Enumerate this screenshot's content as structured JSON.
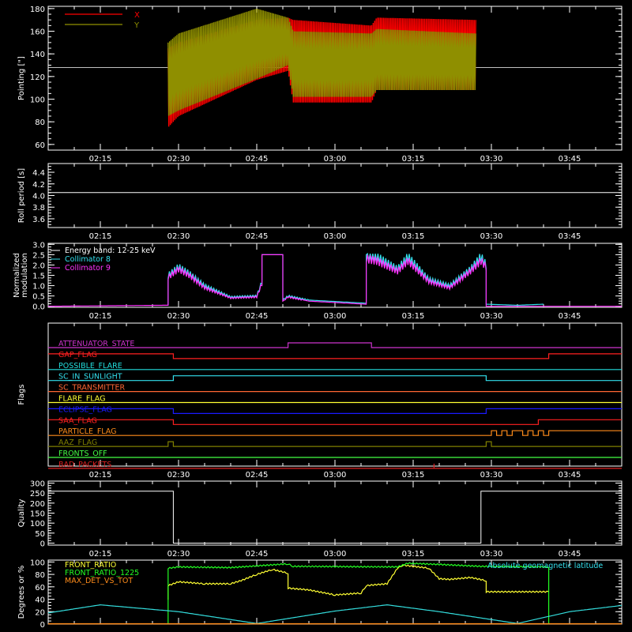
{
  "colors": {
    "background": "#000000",
    "axis": "#ffffff",
    "x": "#ff0000",
    "y": "#8f8f00",
    "cyan": "#33e0ee",
    "magenta": "#ff33ff",
    "green": "#22ff22",
    "yellow": "#ffff33",
    "orange": "#ff8c1a",
    "blue": "#1a1aff",
    "red": "#ff2020",
    "olive": "#808000",
    "lightgreen": "#44ff44",
    "darkred": "#dd2020"
  },
  "time_ticks": [
    "02:15",
    "02:30",
    "02:45",
    "03:00",
    "03:15",
    "03:30",
    "03:45"
  ],
  "chart_data": [
    {
      "name": "pointing",
      "type": "area",
      "ylabel": "Pointing [\"]",
      "ylim": [
        55,
        182
      ],
      "yticks": [
        60,
        80,
        100,
        120,
        140,
        160,
        180
      ],
      "reference_line": 128,
      "legend": [
        "X",
        "Y"
      ],
      "envelopes": [
        {
          "name": "X",
          "color": "#ff0000",
          "x": [
            "02:28",
            "02:30",
            "02:45",
            "02:51",
            "02:52",
            "03:07",
            "03:08",
            "03:27"
          ],
          "min": [
            75,
            85,
            117,
            125,
            97,
            97,
            108,
            108
          ],
          "max": [
            145,
            150,
            170,
            172,
            170,
            165,
            172,
            170
          ]
        },
        {
          "name": "Y",
          "color": "#8f8f00",
          "x": [
            "02:28",
            "02:30",
            "02:45",
            "02:51",
            "02:52",
            "03:07",
            "03:08",
            "03:27"
          ],
          "min": [
            85,
            90,
            118,
            130,
            102,
            102,
            108,
            108
          ],
          "max": [
            150,
            158,
            180,
            172,
            160,
            158,
            162,
            158
          ]
        }
      ]
    },
    {
      "name": "roll-period",
      "type": "line",
      "ylabel": "Roll period [s]",
      "ylim": [
        3.45,
        4.55
      ],
      "yticks": [
        "3.6",
        "3.8",
        "4.0",
        "4.2",
        "4.4"
      ],
      "series": [
        {
          "color": "#ffffff",
          "x": [
            "02:05",
            "03:55"
          ],
          "y": [
            4.05,
            4.05
          ]
        }
      ]
    },
    {
      "name": "modulation",
      "type": "line",
      "ylabel": [
        "Normalized",
        "modulation"
      ],
      "ylim": [
        -0.05,
        3.05
      ],
      "yticks": [
        "0.0",
        "0.5",
        "1.0",
        "1.5",
        "2.0",
        "2.5",
        "3.0"
      ],
      "legend": [
        "Energy band: 12-25 keV",
        "Collimator 8",
        "Collimator 9"
      ],
      "series": [
        {
          "name": "Collimator 8",
          "color": "#33e0ee",
          "x": [
            "02:28",
            "02:28",
            "02:30",
            "02:32",
            "02:35",
            "02:40",
            "02:45",
            "02:46",
            "02:46",
            "02:50",
            "02:50",
            "02:51",
            "02:55",
            "03:06",
            "03:06",
            "03:08",
            "03:12",
            "03:14",
            "03:18",
            "03:22",
            "03:26",
            "03:28",
            "03:29",
            "03:29",
            "03:35",
            "03:40"
          ],
          "y": [
            0.05,
            1.5,
            1.9,
            1.6,
            1.0,
            0.45,
            0.5,
            1.2,
            2.5,
            2.5,
            0.3,
            0.5,
            0.3,
            0.15,
            2.5,
            2.4,
            1.8,
            2.4,
            1.3,
            1.0,
            1.8,
            2.4,
            2.0,
            0.1,
            0.05,
            0.1
          ]
        },
        {
          "name": "Collimator 9",
          "color": "#ff33ff",
          "x": [
            "02:05",
            "02:28",
            "02:28",
            "02:30",
            "02:32",
            "02:35",
            "02:40",
            "02:45",
            "02:46",
            "02:46",
            "02:50",
            "02:50",
            "02:51",
            "02:55",
            "03:06",
            "03:06",
            "03:08",
            "03:12",
            "03:14",
            "03:18",
            "03:22",
            "03:26",
            "03:28",
            "03:29",
            "03:29",
            "03:55"
          ],
          "y": [
            0.0,
            0.05,
            1.4,
            1.8,
            1.5,
            0.9,
            0.4,
            0.45,
            1.1,
            2.5,
            2.5,
            0.25,
            0.45,
            0.25,
            0.1,
            2.3,
            2.2,
            1.7,
            2.2,
            1.2,
            0.9,
            1.7,
            2.2,
            1.9,
            0.0,
            0.0
          ]
        }
      ]
    },
    {
      "name": "flags",
      "type": "line",
      "ylabel": "Flags",
      "flags": [
        {
          "label": "ATTENUATOR_STATE",
          "color": "#cc33cc",
          "x": [
            "02:05",
            "02:51",
            "02:51",
            "03:07",
            "03:07",
            "03:55"
          ],
          "y": [
            0,
            0,
            1,
            1,
            0,
            0
          ]
        },
        {
          "label": "GAP_FLAG",
          "color": "#ff2020",
          "x": [
            "02:05",
            "02:29",
            "02:29",
            "03:41",
            "03:41",
            "03:55"
          ],
          "y": [
            1,
            1,
            0,
            0,
            1,
            1
          ]
        },
        {
          "label": "POSSIBLE_FLARE",
          "color": "#22dddd",
          "x": [
            "02:05",
            "03:55"
          ],
          "y": [
            0,
            0
          ]
        },
        {
          "label": "SC_IN_SUNLIGHT",
          "color": "#33e0ee",
          "x": [
            "02:05",
            "02:29",
            "02:29",
            "03:29",
            "03:29",
            "03:55"
          ],
          "y": [
            0,
            0,
            1,
            1,
            0,
            0
          ]
        },
        {
          "label": "SC_TRANSMITTER",
          "color": "#ff6633",
          "x": [
            "02:05",
            "03:55"
          ],
          "y": [
            0,
            0
          ]
        },
        {
          "label": "FLARE_FLAG",
          "color": "#ffff33",
          "x": [
            "02:05",
            "03:55"
          ],
          "y": [
            0,
            0
          ]
        },
        {
          "label": "ECLIPSE_FLAG",
          "color": "#1a1aff",
          "x": [
            "02:05",
            "02:29",
            "02:29",
            "03:29",
            "03:29",
            "03:55"
          ],
          "y": [
            1,
            1,
            0,
            0,
            1,
            1
          ]
        },
        {
          "label": "SAA_FLAG",
          "color": "#ff2020",
          "x": [
            "02:05",
            "02:29",
            "02:29",
            "03:39",
            "03:39",
            "03:55"
          ],
          "y": [
            1,
            1,
            0,
            0,
            1,
            1
          ]
        },
        {
          "label": "PARTICLE_FLAG",
          "color": "#ff8c1a",
          "x": [
            "02:05",
            "03:30",
            "03:30",
            "03:31",
            "03:31",
            "03:32",
            "03:32",
            "03:33",
            "03:33",
            "03:34",
            "03:34",
            "03:36",
            "03:36",
            "03:37",
            "03:37",
            "03:38",
            "03:38",
            "03:39",
            "03:39",
            "03:40",
            "03:40",
            "03:41",
            "03:41",
            "03:55"
          ],
          "y": [
            0,
            0,
            1,
            1,
            0,
            0,
            1,
            1,
            0,
            0,
            1,
            1,
            0,
            0,
            1,
            1,
            0,
            0,
            1,
            1,
            0,
            0,
            1,
            1
          ]
        },
        {
          "label": "AAZ_FLAG",
          "color": "#808000",
          "x": [
            "02:05",
            "02:28",
            "02:28",
            "02:29",
            "02:29",
            "03:29",
            "03:29",
            "03:30",
            "03:30",
            "03:55"
          ],
          "y": [
            0,
            0,
            1,
            1,
            0,
            0,
            1,
            1,
            0,
            0
          ]
        },
        {
          "label": "FRONTS_OFF",
          "color": "#44ff44",
          "x": [
            "02:05",
            "03:55"
          ],
          "y": [
            0,
            0
          ]
        },
        {
          "label": "BAD_PACKETS",
          "color": "#dd2020",
          "x": [
            "02:05",
            "03:19",
            "03:19",
            "03:19",
            "03:19",
            "03:55"
          ],
          "y": [
            0,
            0,
            1,
            1,
            0,
            0
          ]
        }
      ]
    },
    {
      "name": "quality",
      "type": "line",
      "ylabel": "Quality",
      "ylim": [
        -10,
        310
      ],
      "yticks": [
        0,
        50,
        100,
        150,
        200,
        250,
        300
      ],
      "series": [
        {
          "color": "#ffffff",
          "x": [
            "02:05",
            "02:29",
            "02:29",
            "03:28",
            "03:28",
            "03:55"
          ],
          "y": [
            260,
            260,
            0,
            0,
            260,
            260
          ]
        }
      ]
    },
    {
      "name": "ratios",
      "type": "line",
      "ylabel": "Degrees or %",
      "ylim": [
        0,
        103
      ],
      "yticks": [
        0,
        20,
        40,
        60,
        80,
        100
      ],
      "legend": [
        "FRONT_RATIO",
        "FRONT_RATIO_1225",
        "MAX_DET_VS_TOT",
        "Absolute geomagnetic latitude"
      ],
      "series": [
        {
          "name": "FRONT_RATIO",
          "color": "#ffff33",
          "x": [
            "02:28",
            "02:28",
            "02:30",
            "02:35",
            "02:40",
            "02:42",
            "02:45",
            "02:48",
            "02:51",
            "02:51",
            "02:55",
            "03:00",
            "03:05",
            "03:06",
            "03:10",
            "03:12",
            "03:13",
            "03:18",
            "03:20",
            "03:22",
            "03:26",
            "03:29",
            "03:29",
            "03:35",
            "03:41"
          ],
          "y": [
            40,
            62,
            68,
            65,
            65,
            70,
            80,
            88,
            82,
            58,
            55,
            47,
            50,
            62,
            65,
            90,
            95,
            90,
            73,
            72,
            75,
            70,
            52,
            52,
            52
          ]
        },
        {
          "name": "FRONT_RATIO_1225",
          "color": "#22ff22",
          "x": [
            "02:28",
            "02:28",
            "02:30",
            "02:40",
            "02:51",
            "02:52",
            "03:12",
            "03:14",
            "03:20",
            "03:28",
            "03:41",
            "03:41"
          ],
          "y": [
            0,
            90,
            92,
            91,
            97,
            93,
            92,
            98,
            96,
            93,
            92,
            0
          ]
        },
        {
          "name": "Absolute geomagnetic latitude",
          "color": "#33dddd",
          "x": [
            "02:05",
            "02:15",
            "02:30",
            "02:45",
            "03:00",
            "03:10",
            "03:20",
            "03:35",
            "03:45",
            "03:55"
          ],
          "y": [
            18,
            31,
            20,
            1,
            21,
            31,
            20,
            1,
            20,
            30
          ]
        }
      ]
    }
  ]
}
